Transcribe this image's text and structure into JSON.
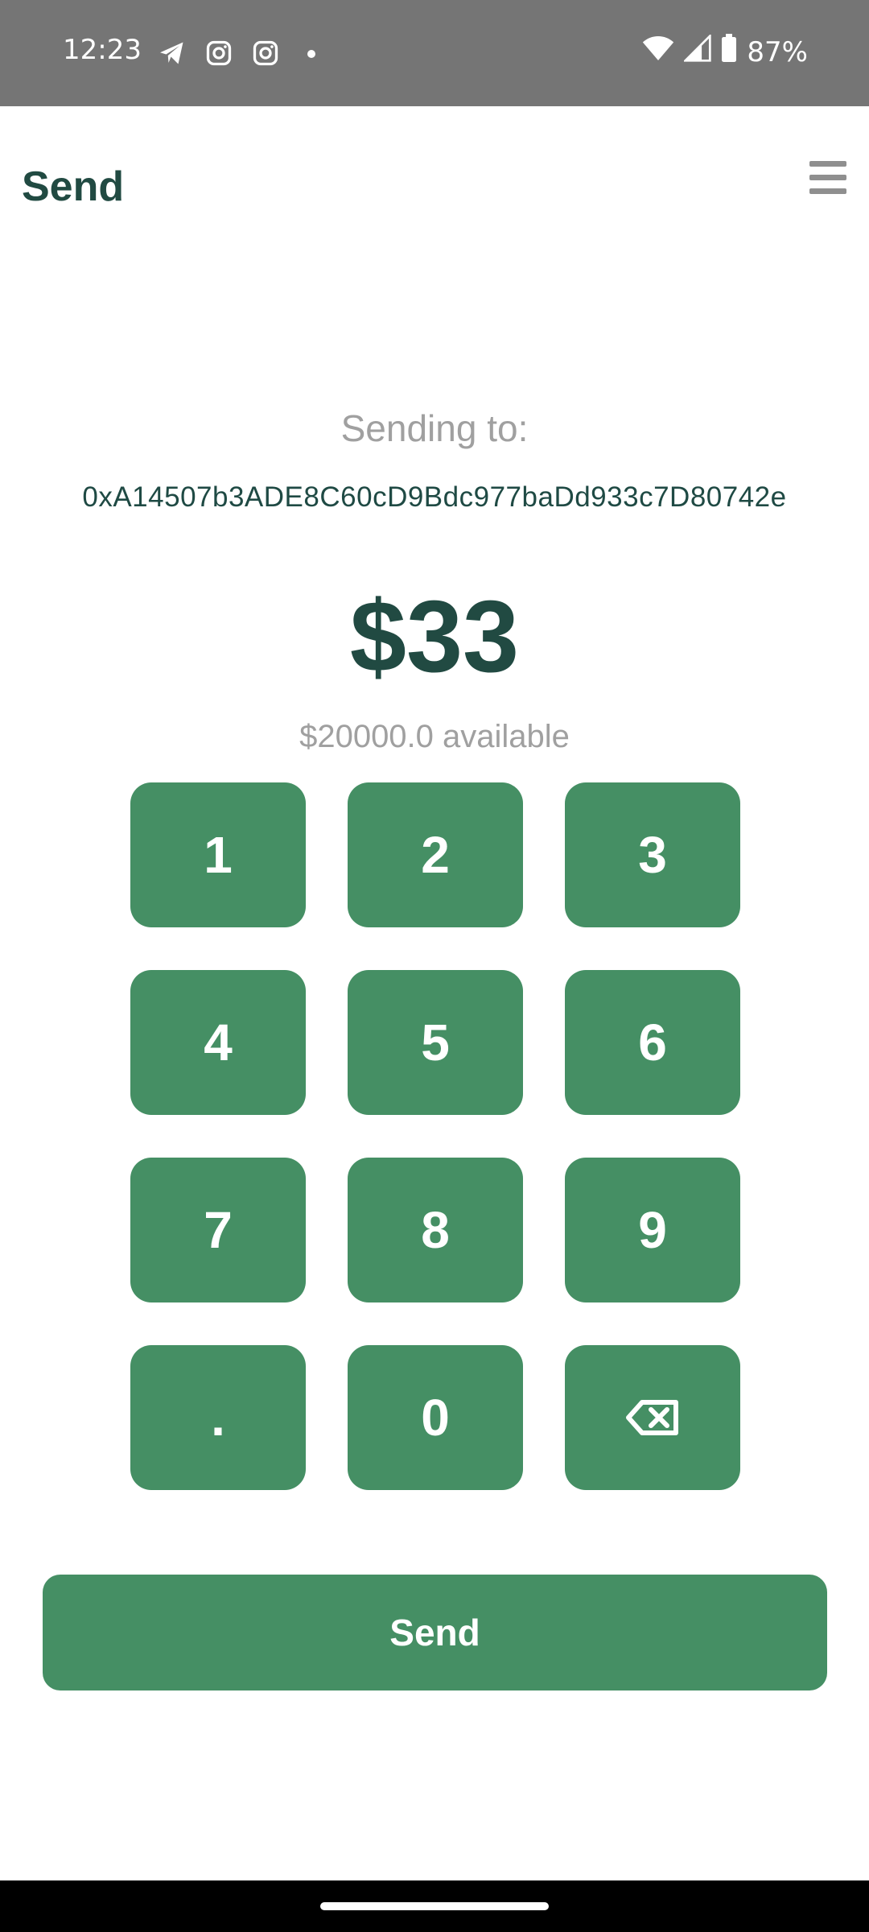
{
  "status_bar": {
    "time": "12:23",
    "notification_icons": [
      "telegram-icon",
      "instagram-icon",
      "instagram-icon"
    ],
    "battery": "87%"
  },
  "header": {
    "title": "Send",
    "menu_icon": "hamburger-menu-icon"
  },
  "recipient": {
    "label": "Sending to:",
    "address": "0xA14507b3ADE8C60cD9Bdc977baDd933c7D80742e"
  },
  "amount": {
    "value": "$33",
    "available": "$20000.0 available"
  },
  "keypad": {
    "keys": [
      "1",
      "2",
      "3",
      "4",
      "5",
      "6",
      "7",
      "8",
      "9",
      ".",
      "0"
    ],
    "backspace_icon": "backspace-icon"
  },
  "send_button": {
    "label": "Send"
  },
  "colors": {
    "accent_green": "#458f64",
    "title_dark_green": "#214a42",
    "muted_gray": "#a0a0a0",
    "status_bar_gray": "#757575"
  }
}
